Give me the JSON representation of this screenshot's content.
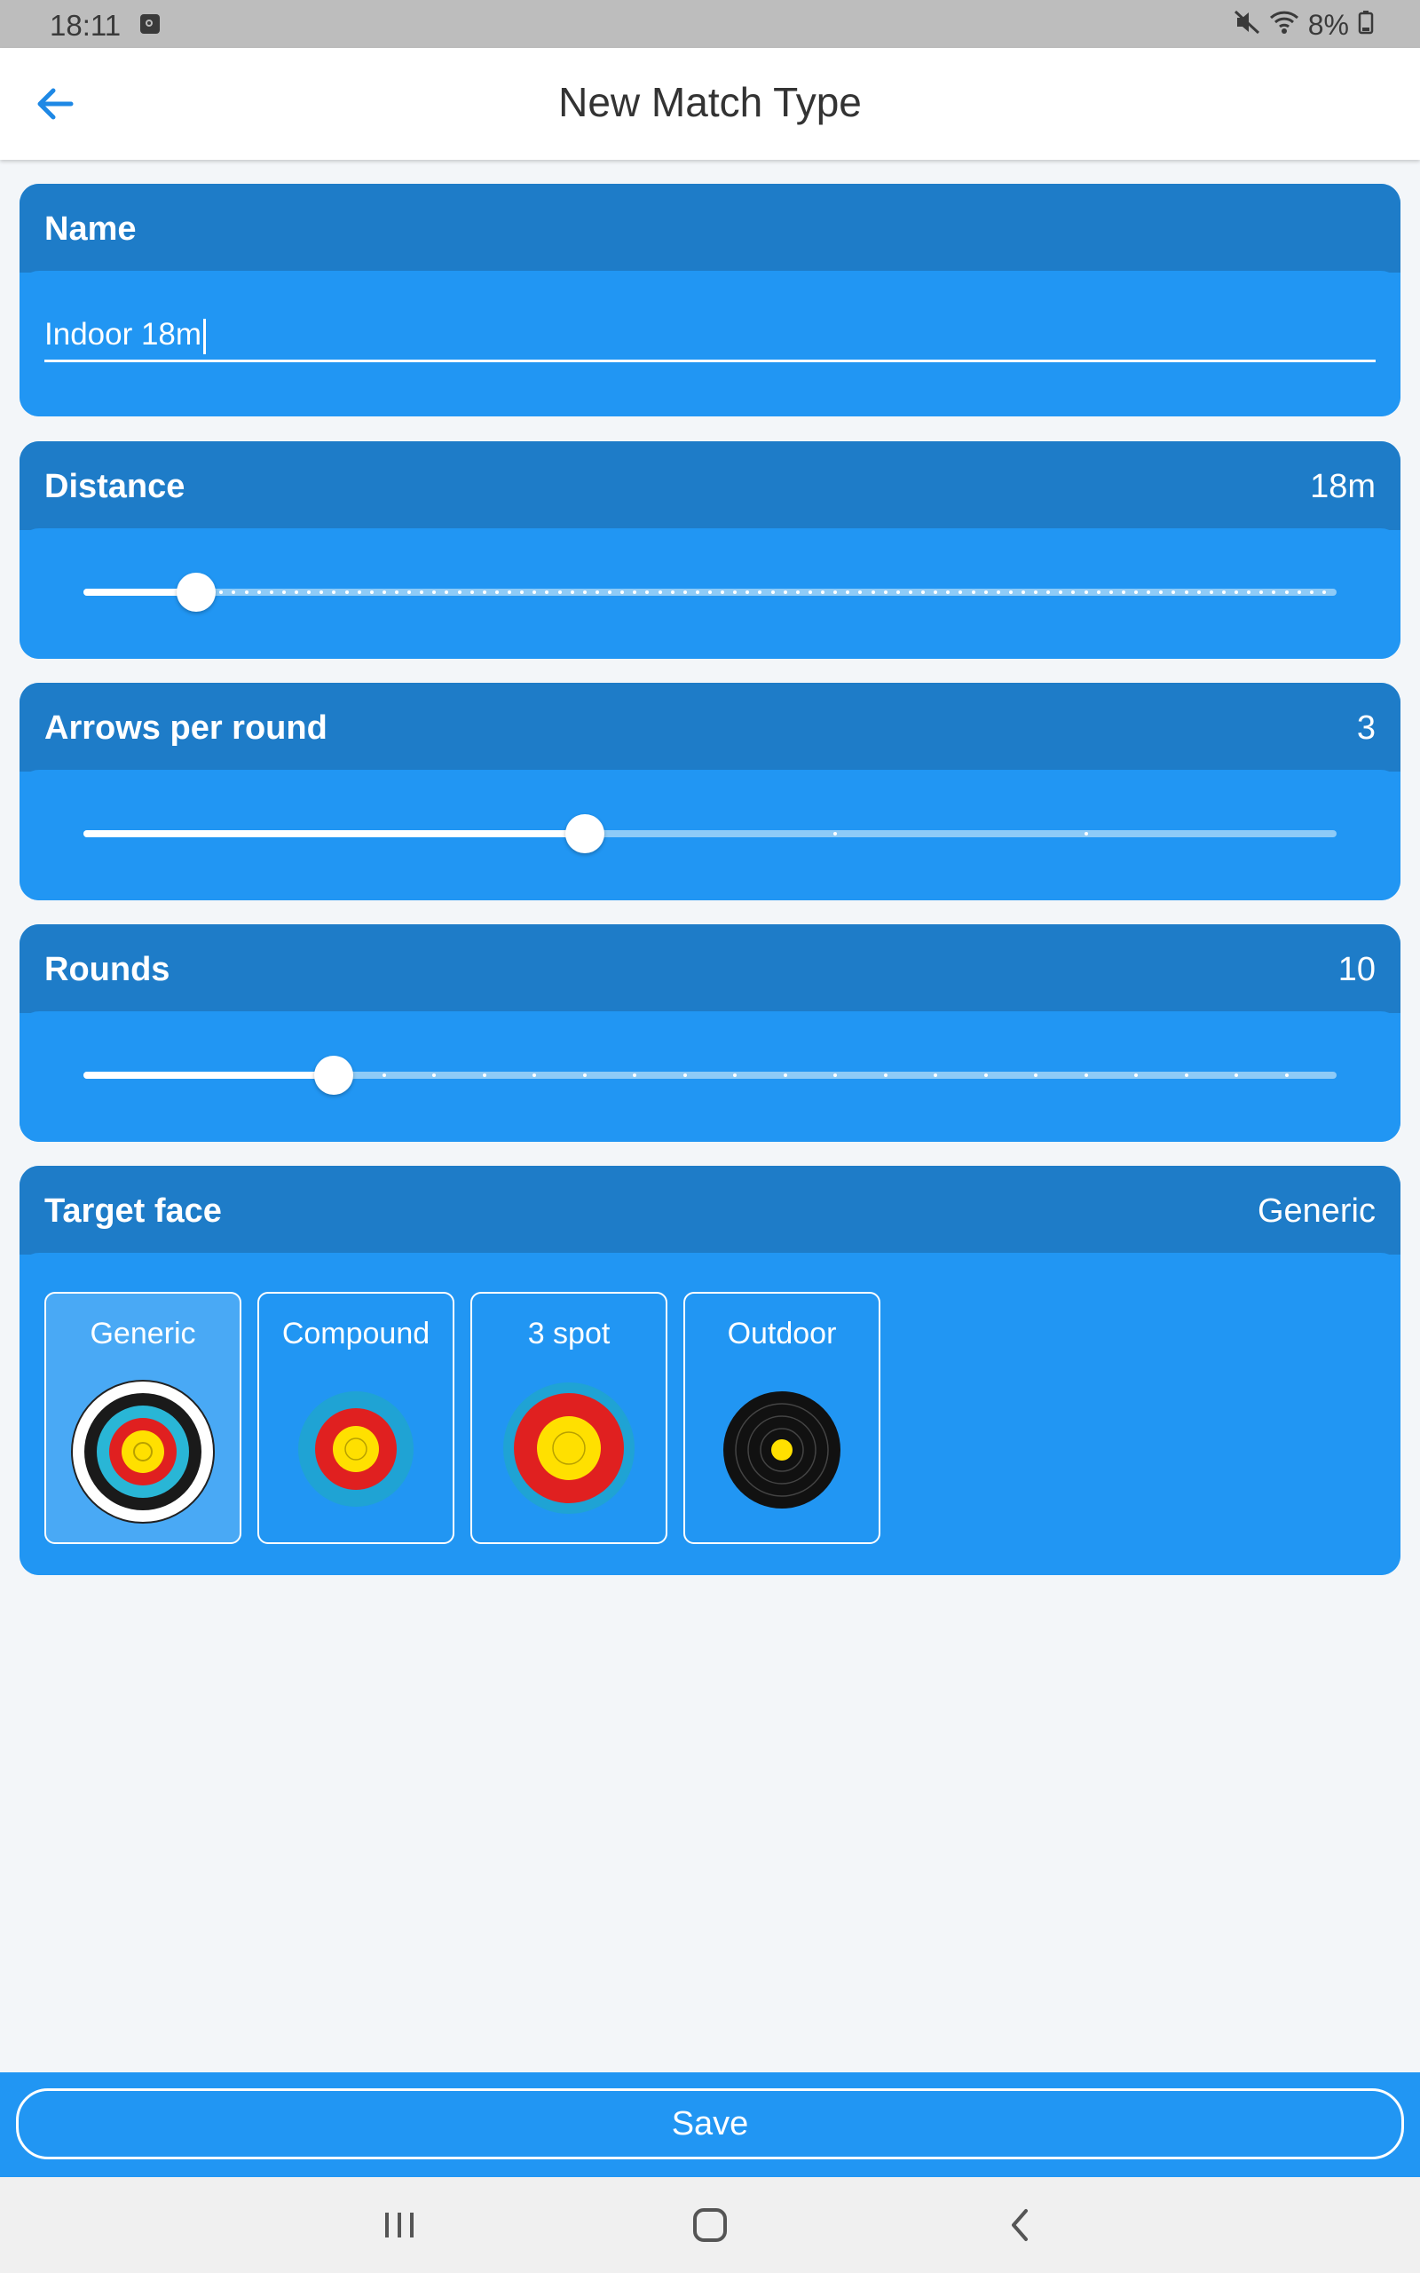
{
  "status": {
    "time": "18:11",
    "battery": "8%",
    "icons": [
      "mute-icon",
      "wifi-icon",
      "battery-icon"
    ]
  },
  "appbar": {
    "title": "New Match Type",
    "back_icon": "arrow-left-icon"
  },
  "name": {
    "label": "Name",
    "value": "Indoor 18m"
  },
  "distance": {
    "label": "Distance",
    "value": "18m",
    "level": 0.09
  },
  "arrows": {
    "label": "Arrows per round",
    "value": "3",
    "level": 0.4
  },
  "rounds": {
    "label": "Rounds",
    "value": "10",
    "level": 0.2
  },
  "target": {
    "label": "Target face",
    "value": "Generic",
    "options": [
      {
        "label": "Generic",
        "selected": true
      },
      {
        "label": "Compound",
        "selected": false
      },
      {
        "label": "3 spot",
        "selected": false
      },
      {
        "label": "Outdoor",
        "selected": false
      }
    ]
  },
  "save": {
    "label": "Save"
  },
  "colors": {
    "primary": "#2196f3",
    "header": "#1e7cc8",
    "background": "#f3f6f9"
  }
}
